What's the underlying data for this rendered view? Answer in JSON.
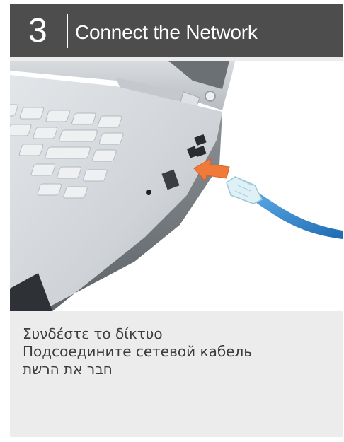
{
  "step": {
    "number": "3",
    "title": "Connect the Network"
  },
  "illustration": {
    "subject": "laptop-network-port-and-ethernet-cable",
    "arrow_color": "#f07a3a",
    "cable_color": "#2f7fc4"
  },
  "captions": [
    "Συνδέστε το δίκτυο",
    "Подсоедините сетевой кабель",
    "חבר את הרשת"
  ],
  "colors": {
    "header_bg": "#4d4d4d",
    "panel_bg": "#ececec",
    "text": "#3c3c3c"
  }
}
